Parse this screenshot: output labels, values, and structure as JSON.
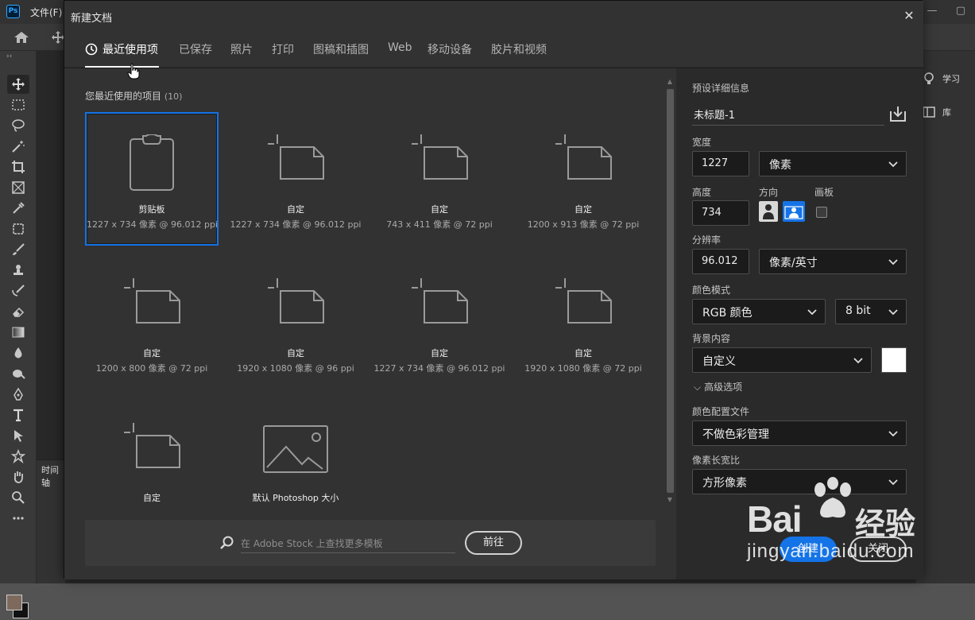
{
  "app": {
    "logo": "Ps",
    "file_menu": "文件(F)",
    "window_buttons": [
      "—",
      "▢"
    ]
  },
  "right_panel": {
    "learn_label": "学习",
    "library_label": "库"
  },
  "timeline_tab": "时间轴",
  "dialog": {
    "title": "新建文档",
    "tabs": [
      {
        "label": "最近使用项",
        "active": true
      },
      {
        "label": "已保存"
      },
      {
        "label": "照片"
      },
      {
        "label": "打印"
      },
      {
        "label": "图稿和插图"
      },
      {
        "label": "Web"
      },
      {
        "label": "移动设备"
      },
      {
        "label": "胶片和视频"
      }
    ],
    "recent": {
      "heading": "您最近使用的项目",
      "count": "(10)",
      "items": [
        {
          "name": "剪贴板",
          "dims": "1227 x 734 像素 @ 96.012 ppi",
          "icon": "clipboard-icon"
        },
        {
          "name": "自定",
          "dims": "1227 x 734 像素 @ 96.012 ppi",
          "icon": "custom-document-icon"
        },
        {
          "name": "自定",
          "dims": "743 x 411 像素 @ 72 ppi",
          "icon": "custom-document-icon"
        },
        {
          "name": "自定",
          "dims": "1200 x 913 像素 @ 72 ppi",
          "icon": "custom-document-icon"
        },
        {
          "name": "自定",
          "dims": "1200 x 800 像素 @ 72 ppi",
          "icon": "custom-document-icon"
        },
        {
          "name": "自定",
          "dims": "1920 x 1080 像素 @ 96 ppi",
          "icon": "custom-document-icon"
        },
        {
          "name": "自定",
          "dims": "1227 x 734 像素 @ 96.012 ppi",
          "icon": "custom-document-icon"
        },
        {
          "name": "自定",
          "dims": "1920 x 1080 像素 @ 72 ppi",
          "icon": "custom-document-icon"
        },
        {
          "name": "自定",
          "dims": "",
          "icon": "custom-document-icon"
        },
        {
          "name": "默认 Photoshop 大小",
          "dims": "",
          "icon": "image-icon"
        }
      ]
    },
    "stock": {
      "placeholder": "在 Adobe Stock 上查找更多模板",
      "go_label": "前往"
    },
    "details": {
      "heading": "预设详细信息",
      "doc_name": "未标题-1",
      "width_label": "宽度",
      "width_value": "1227",
      "width_unit": "像素",
      "height_label": "高度",
      "height_value": "734",
      "orientation_label": "方向",
      "artboard_label": "画板",
      "resolution_label": "分辨率",
      "resolution_value": "96.012",
      "resolution_unit": "像素/英寸",
      "color_mode_label": "颜色模式",
      "color_mode_value": "RGB 颜色",
      "bit_depth": "8 bit",
      "background_label": "背景内容",
      "background_value": "自定义",
      "background_color": "#ffffff",
      "advanced_label": "高级选项",
      "color_profile_label": "颜色配置文件",
      "color_profile_value": "不做色彩管理",
      "pixel_aspect_label": "像素长宽比",
      "pixel_aspect_value": "方形像素",
      "create_label": "创建",
      "close_label": "关闭"
    }
  },
  "watermark": {
    "brand": "Bai",
    "cn": "经验",
    "url": "jingyan.baidu.com"
  },
  "colors": {
    "accent": "#1473e6",
    "dialog_bg": "#323232",
    "panel_bg": "#2a2a2a",
    "foreground_swatch": "#7d6a5d",
    "background_swatch": "#111111"
  }
}
